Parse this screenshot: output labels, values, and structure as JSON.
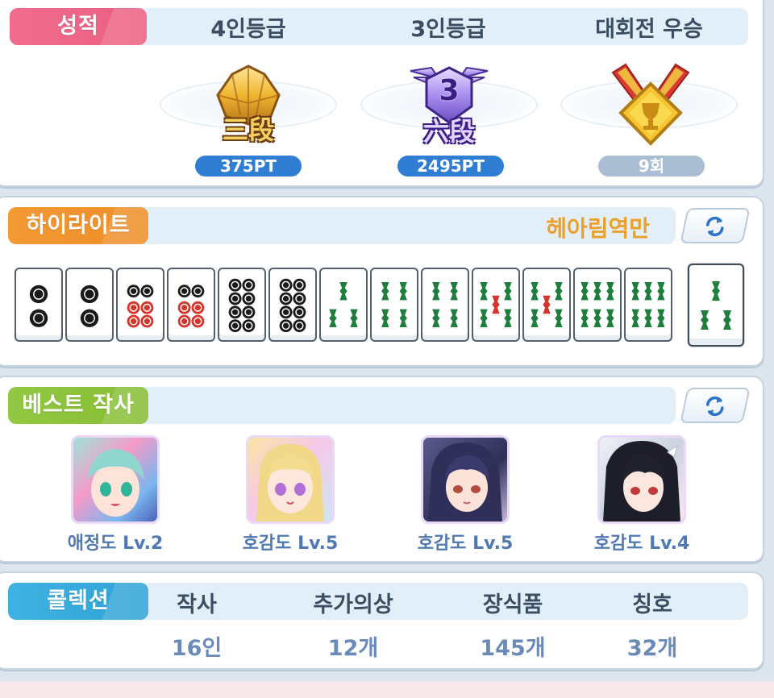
{
  "grades": {
    "section_label": "성적",
    "columns": [
      {
        "title": "4인등급",
        "badge_text": "三段",
        "value": "375PT"
      },
      {
        "title": "3인등급",
        "badge_text": "六段",
        "badge_number": "3",
        "value": "2495PT"
      },
      {
        "title": "대회전 우승",
        "value": "9회"
      }
    ]
  },
  "highlight": {
    "section_label": "하이라이트",
    "yaku": "헤아림역만",
    "tiles": [
      {
        "suit": "pin",
        "count": 2
      },
      {
        "suit": "pin",
        "count": 2
      },
      {
        "suit": "pin",
        "count": 6
      },
      {
        "suit": "pin",
        "count": 6
      },
      {
        "suit": "pin",
        "count": 8
      },
      {
        "suit": "pin",
        "count": 8
      },
      {
        "suit": "sou",
        "count": 3
      },
      {
        "suit": "sou",
        "count": 4
      },
      {
        "suit": "sou",
        "count": 4
      },
      {
        "suit": "sou",
        "count": 5
      },
      {
        "suit": "sou",
        "count": 5
      },
      {
        "suit": "sou",
        "count": 6
      },
      {
        "suit": "sou",
        "count": 6
      },
      {
        "suit": "sou",
        "count": 3,
        "winning": true
      }
    ]
  },
  "best": {
    "section_label": "베스트 작사",
    "characters": [
      {
        "label": "애정도 Lv.2"
      },
      {
        "label": "호감도 Lv.5"
      },
      {
        "label": "호감도 Lv.5"
      },
      {
        "label": "호감도 Lv.4"
      }
    ]
  },
  "collection": {
    "section_label": "콜렉션",
    "items": [
      {
        "title": "작사",
        "value": "16인"
      },
      {
        "title": "추가의상",
        "value": "12개"
      },
      {
        "title": "장식품",
        "value": "145개"
      },
      {
        "title": "칭호",
        "value": "32개"
      }
    ]
  },
  "colors": {
    "grades_tag": "#ee6e8e",
    "highlight_tag": "#f0962e",
    "best_tag": "#8cc23a",
    "collection_tag": "#35aadd",
    "pin_black": "#1a1a1a",
    "pin_red": "#d5362b",
    "sou_green": "#1f7d3d",
    "sou_red": "#d5362b"
  },
  "icons": {
    "refresh": "refresh-icon",
    "rank4": "gold-rank-badge-icon",
    "rank3": "purple-winged-rank-badge-icon",
    "trophy": "gold-medal-trophy-icon"
  }
}
